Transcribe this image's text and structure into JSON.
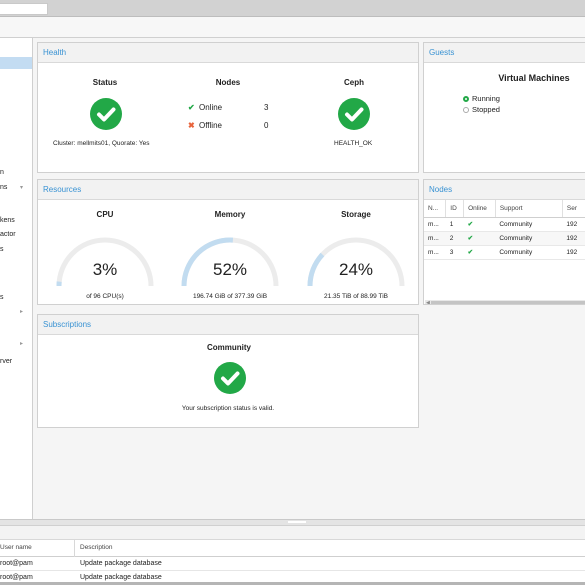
{
  "sidebar": {
    "items": [
      {
        "label": "n"
      },
      {
        "label": "ns"
      },
      {
        "label": "kens"
      },
      {
        "label": "actor"
      },
      {
        "label": "s"
      },
      {
        "label": "s"
      },
      {
        "label": "rver"
      }
    ]
  },
  "health": {
    "title": "Health",
    "status": {
      "heading": "Status",
      "caption": "Cluster: mellmits01, Quorate: Yes"
    },
    "nodes": {
      "heading": "Nodes",
      "online_label": "Online",
      "online_count": "3",
      "offline_label": "Offline",
      "offline_count": "0"
    },
    "ceph": {
      "heading": "Ceph",
      "caption": "HEALTH_OK"
    }
  },
  "guests": {
    "title": "Guests",
    "heading": "Virtual Machines",
    "running_label": "Running",
    "stopped_label": "Stopped"
  },
  "resources": {
    "title": "Resources",
    "gauges": [
      {
        "heading": "CPU",
        "value_text": "3%",
        "fraction": 0.03,
        "caption": "of 96 CPU(s)"
      },
      {
        "heading": "Memory",
        "value_text": "52%",
        "fraction": 0.52,
        "caption": "196.74 GiB of 377.39 GiB"
      },
      {
        "heading": "Storage",
        "value_text": "24%",
        "fraction": 0.24,
        "caption": "21.35 TiB of 88.99 TiB"
      }
    ]
  },
  "nodes_panel": {
    "title": "Nodes",
    "columns": [
      "N...",
      "ID",
      "Online",
      "Support",
      "Ser"
    ],
    "rows": [
      {
        "name": "m...",
        "id": "1",
        "support": "Community",
        "server": "192"
      },
      {
        "name": "m...",
        "id": "2",
        "support": "Community",
        "server": "192"
      },
      {
        "name": "m...",
        "id": "3",
        "support": "Community",
        "server": "192"
      }
    ]
  },
  "subscriptions": {
    "title": "Subscriptions",
    "heading": "Community",
    "caption": "Your subscription status is valid."
  },
  "tasks": {
    "columns": {
      "user": "User name",
      "description": "Description"
    },
    "rows": [
      {
        "user": "root@pam",
        "description": "Update package database"
      },
      {
        "user": "root@pam",
        "description": "Update package database"
      }
    ]
  },
  "colors": {
    "accent": "#3892d3",
    "ok_green": "#22a847",
    "offline_red": "#e8643c",
    "gauge_fill": "#c2dcf0",
    "gauge_track": "#ececec"
  },
  "icons": [
    "check-circle-icon",
    "checkmark-icon",
    "cross-icon",
    "chevron-down-icon",
    "chevron-right-icon"
  ]
}
